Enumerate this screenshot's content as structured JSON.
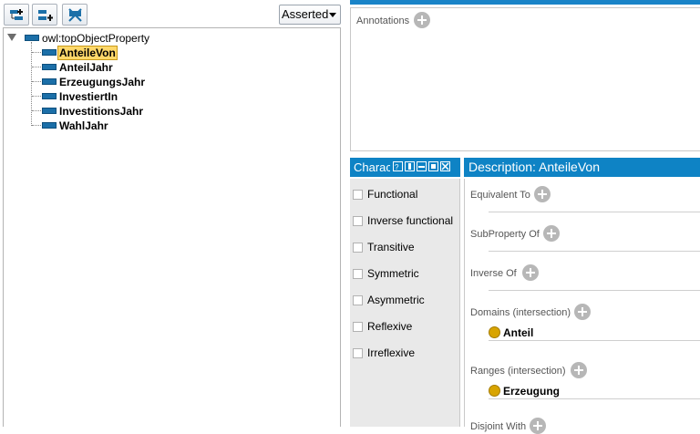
{
  "toolbar": {
    "buttons": [
      {
        "name": "add-sub-property-icon"
      },
      {
        "name": "add-sibling-property-icon"
      },
      {
        "name": "delete-property-icon"
      }
    ],
    "view_mode": "Asserted"
  },
  "hierarchy": {
    "root": "owl:topObjectProperty",
    "children": [
      {
        "label": "AnteileVon",
        "selected": true
      },
      {
        "label": "AnteilJahr"
      },
      {
        "label": "ErzeugungsJahr"
      },
      {
        "label": "InvestiertIn"
      },
      {
        "label": "InvestitionsJahr"
      },
      {
        "label": "WahlJahr"
      }
    ]
  },
  "annotations": {
    "label": "Annotations"
  },
  "characteristics": {
    "title": "Characteristics",
    "items": [
      {
        "label": "Functional",
        "checked": false
      },
      {
        "label": "Inverse functional",
        "checked": false
      },
      {
        "label": "Transitive",
        "checked": false
      },
      {
        "label": "Symmetric",
        "checked": false
      },
      {
        "label": "Asymmetric",
        "checked": false
      },
      {
        "label": "Reflexive",
        "checked": false
      },
      {
        "label": "Irreflexive",
        "checked": false
      }
    ]
  },
  "description": {
    "title": "Description: AnteileVon",
    "sections": {
      "equivalent_to": "Equivalent To",
      "subproperty_of": "SubProperty Of",
      "inverse_of": "Inverse Of",
      "domains": "Domains (intersection)",
      "domain_value": "Anteil",
      "ranges": "Ranges (intersection)",
      "range_value": "Erzeugung",
      "disjoint_with": "Disjoint With"
    }
  },
  "colors": {
    "header_blue": "#0e83c5",
    "property_icon": "#1b6fa8",
    "class_dot": "#d8a400",
    "selection": "#ffd86a"
  }
}
